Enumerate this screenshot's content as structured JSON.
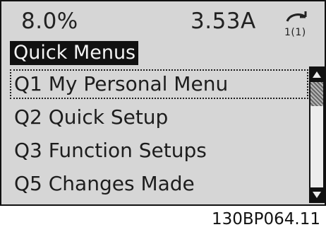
{
  "status": {
    "left_value": "8.0%",
    "right_value": "3.53A",
    "setup_indicator": "1(1)"
  },
  "menu": {
    "title": "Quick Menus",
    "items": [
      {
        "label": "Q1 My Personal Menu",
        "selected": true
      },
      {
        "label": "Q2 Quick Setup",
        "selected": false
      },
      {
        "label": "Q3 Function Setups",
        "selected": false
      },
      {
        "label": "Q5 Changes Made",
        "selected": false
      }
    ]
  },
  "icons": {
    "setup": "setup-cycle-icon",
    "scroll_up": "scroll-up-arrow-icon",
    "scroll_down": "scroll-down-arrow-icon"
  },
  "caption": "130BP064.11",
  "colors": {
    "lcd_background": "#d6d6d6",
    "foreground": "#111111",
    "title_text": "#f4f4f4"
  }
}
